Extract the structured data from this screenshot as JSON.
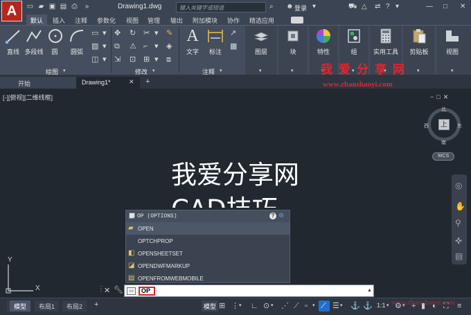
{
  "window": {
    "app_logo": "A",
    "doc_title": "Drawing1.dwg",
    "search_placeholder": "键入关键字或短语",
    "login_label": "登录",
    "controls": [
      "minimize-icon",
      "maximize-icon",
      "close-icon"
    ]
  },
  "ribbon_tabs": [
    "默认",
    "插入",
    "注释",
    "参数化",
    "视图",
    "管理",
    "输出",
    "附加模块",
    "协作",
    "精选应用"
  ],
  "ribbon_tab_active": "默认",
  "ribbon": {
    "draw": {
      "title": "绘图",
      "line": "直线",
      "polyline": "多段线",
      "circle": "圆",
      "arc": "圆弧"
    },
    "modify": {
      "title": "修改"
    },
    "annotation": {
      "title": "注释",
      "text": "文字",
      "dimension": "标注"
    },
    "layers": "图层",
    "block": "块",
    "properties": "特性",
    "groups": "组",
    "utilities": "实用工具",
    "clipboard": "剪贴板",
    "view": "视图"
  },
  "watermark": {
    "cn": "我爱分享网",
    "url": "www.zhanshaoyi.com"
  },
  "file_tabs": {
    "start": "开始",
    "drawing": "Drawing1*"
  },
  "viewport_label": "[-][俯视][二维线框]",
  "canvas_text": [
    "我爱分享网",
    "CAD技巧"
  ],
  "viewcube": {
    "top": "上",
    "north": "北",
    "south": "南",
    "east": "东",
    "west": "西",
    "wcs": "WCS"
  },
  "autocomplete": {
    "header": "OP (OPTIONS)",
    "items": [
      {
        "label": "OPEN",
        "icon": "folder-open-icon"
      },
      {
        "label": "OPTCHPROP",
        "icon": ""
      },
      {
        "label": "OPENSHEETSET",
        "icon": "sheetset-icon"
      },
      {
        "label": "OPENDWFMARKUP",
        "icon": "markup-icon"
      },
      {
        "label": "OPENFROMWEBMOBILE",
        "icon": "web-mobile-icon"
      }
    ]
  },
  "command_line": {
    "value": "OP"
  },
  "ucs": {
    "x": "X",
    "y": "Y"
  },
  "layout_tabs": [
    "模型",
    "布局1",
    "布局2"
  ],
  "layout_active": "模型",
  "status": {
    "model": "模型",
    "scale": "1:1"
  },
  "colors": {
    "brand": "#b52620",
    "accent": "#1f6fd1",
    "watermark": "#e0262e",
    "canvas": "#212830"
  }
}
